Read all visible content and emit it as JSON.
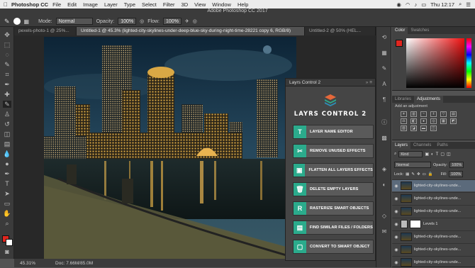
{
  "menubar": {
    "app_name": "Photoshop CC",
    "items": [
      "File",
      "Edit",
      "Image",
      "Layer",
      "Type",
      "Select",
      "Filter",
      "3D",
      "View",
      "Window",
      "Help"
    ],
    "clock": "Thu 12:17"
  },
  "title": "Adobe Photoshop CC 2017",
  "options": {
    "mode_label": "Mode:",
    "mode_value": "Normal",
    "opacity_label": "Opacity:",
    "opacity_value": "100%",
    "flow_label": "Flow:",
    "flow_value": "100%"
  },
  "tabs": [
    "pexels-photo-1 @ 25%...",
    "Untitled-1 @ 45.3% (lighted-city-skylines-under-deep-blue-sky-during-night-time-28221 copy 6, RGB/8)",
    "Untitled-2 @ 50% (HEL..."
  ],
  "status": {
    "zoom": "45.31%",
    "doc": "Doc: 7.66M/85.0M"
  },
  "plugin": {
    "header": "Layrs Control 2",
    "title": "LAYRS CONTROL 2",
    "buttons": [
      {
        "icon": "T",
        "label": "LAYER NAME EDITOR"
      },
      {
        "icon": "✂",
        "label": "REMOVE UNUSED EFFECTS"
      },
      {
        "icon": "▣",
        "label": "FLATTEN ALL LAYERS EFFECTS"
      },
      {
        "icon": "🗑",
        "label": "DELETE EMPTY LAYERS"
      },
      {
        "icon": "R",
        "label": "RASTERIZE SMART OBJECTS"
      },
      {
        "icon": "▤",
        "label": "FIND SIMILAR FILES / FOLDERS"
      },
      {
        "icon": "▢",
        "label": "CONVERT TO SMART OBJECT"
      }
    ]
  },
  "color_panel": {
    "tabs": [
      "Color",
      "Swatches"
    ]
  },
  "adjustments_panel": {
    "tabs": [
      "Libraries",
      "Adjustments"
    ],
    "hint": "Add an adjustment"
  },
  "layers_panel": {
    "tabs": [
      "Layers",
      "Channels",
      "Paths"
    ],
    "kind": "Kind",
    "blend": "Normal",
    "opacity_label": "Opacity:",
    "opacity_value": "100%",
    "lock_label": "Lock:",
    "fill_label": "Fill:",
    "fill_value": "100%",
    "layers": [
      "lighted-city-skylines-unde...",
      "lighted-city-skylines-unde...",
      "lighted-city-skylines-unde...",
      "Levels 1",
      "lighted-city-skylines-unde...",
      "lighted-city-skylines-unde...",
      "lighted-city-skylines-unde..."
    ]
  },
  "colors": {
    "accent": "#2bab8c",
    "fg_swatch": "#e0261f",
    "bg_swatch": "#ffffff"
  }
}
